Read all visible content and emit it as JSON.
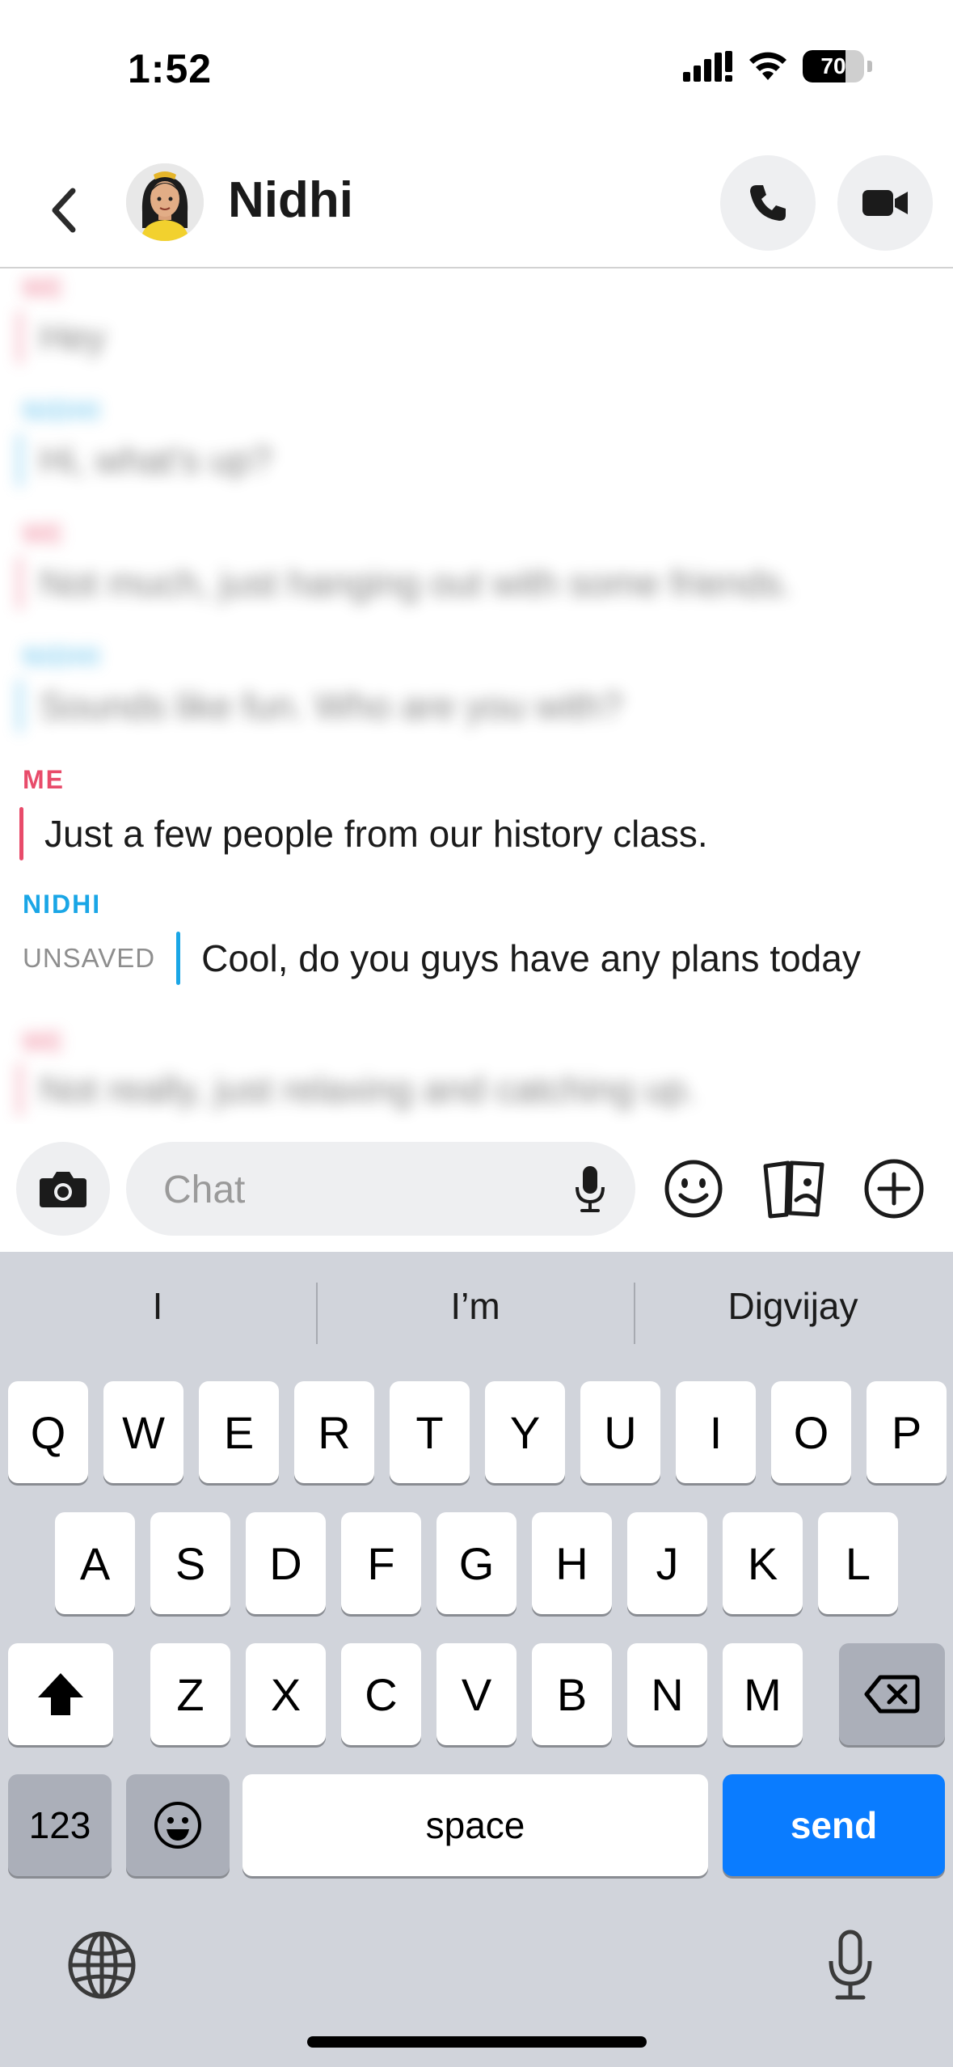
{
  "status_bar": {
    "time": "1:52",
    "battery": "70",
    "battery_level": 0.7
  },
  "header": {
    "contact_name": "Nidhi",
    "icons": {
      "back": "chevron-left-icon",
      "call": "phone-icon",
      "video": "video-camera-icon"
    }
  },
  "messages": [
    {
      "sender": "ME",
      "text": "Hey",
      "blurred": true
    },
    {
      "sender": "NIDHI",
      "text": "Hi, what's up?",
      "blurred": true
    },
    {
      "sender": "ME",
      "text": "Not much, just hanging out with some friends.",
      "blurred": true
    },
    {
      "sender": "NIDHI",
      "text": "Sounds like fun. Who are you with?",
      "blurred": true
    },
    {
      "sender": "ME",
      "text": "Just a few people from our history class.",
      "blurred": false
    },
    {
      "sender": "NIDHI",
      "status": "UNSAVED",
      "text": "Cool, do you guys have any plans today",
      "blurred": false
    },
    {
      "sender": "ME",
      "text": "Not really, just relaxing and catching up.",
      "blurred": true
    }
  ],
  "input": {
    "placeholder": "Chat"
  },
  "keyboard": {
    "suggestions": [
      "I",
      "I’m",
      "Digvijay"
    ],
    "row1": [
      "Q",
      "W",
      "E",
      "R",
      "T",
      "Y",
      "U",
      "I",
      "O",
      "P"
    ],
    "row2": [
      "A",
      "S",
      "D",
      "F",
      "G",
      "H",
      "J",
      "K",
      "L"
    ],
    "row3": [
      "Z",
      "X",
      "C",
      "V",
      "B",
      "N",
      "M"
    ],
    "numbers_label": "123",
    "space_label": "space",
    "send_label": "send"
  },
  "colors": {
    "me": "#e84b6a",
    "nidhi": "#1aa6e6",
    "send": "#0a7cff"
  }
}
